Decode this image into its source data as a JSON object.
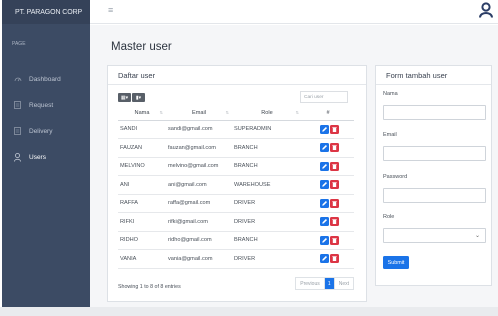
{
  "sidebar": {
    "brand": "PT. PARAGON CORP",
    "section_label": "PAGE",
    "items": [
      {
        "label": "Dashboard",
        "icon": "dashboard-icon"
      },
      {
        "label": "Request",
        "icon": "document-icon"
      },
      {
        "label": "Delivery",
        "icon": "document-icon"
      },
      {
        "label": "Users",
        "icon": "user-icon"
      }
    ],
    "active": "Users"
  },
  "topbar": {
    "menu_icon": "hamburger-icon",
    "user_icon": "user-circle-icon"
  },
  "page": {
    "title": "Master user"
  },
  "list": {
    "title": "Daftar user",
    "search_placeholder": "Cari user",
    "columns": [
      "Nama",
      "Email",
      "Role",
      "#"
    ],
    "rows": [
      {
        "nama": "SANDI",
        "email": "sandi@gmail.com",
        "role": "SUPERADMIN"
      },
      {
        "nama": "FAUZAN",
        "email": "fauzan@gmail.com",
        "role": "BRANCH"
      },
      {
        "nama": "MELVINO",
        "email": "melvino@gmail.com",
        "role": "BRANCH"
      },
      {
        "nama": "ANI",
        "email": "ani@gmail.com",
        "role": "WAREHOUSE"
      },
      {
        "nama": "RAFFA",
        "email": "raffa@gmail.com",
        "role": "DRIVER"
      },
      {
        "nama": "RIFKI",
        "email": "rifki@gmail.com",
        "role": "DRIVER"
      },
      {
        "nama": "RIDHO",
        "email": "ridho@gmail.com",
        "role": "BRANCH"
      },
      {
        "nama": "VANIA",
        "email": "vania@gmail.com",
        "role": "DRIVER"
      }
    ],
    "info": "Showing 1 to 8 of 8 entries",
    "pagination": {
      "prev": "Previous",
      "current": "1",
      "next": "Next"
    }
  },
  "form": {
    "title": "Form tambah user",
    "nama_label": "Nama",
    "email_label": "Email",
    "password_label": "Password",
    "role_label": "Role",
    "submit_label": "Submit"
  },
  "colors": {
    "sidebar": "#3c4b64",
    "primary": "#1a73e8",
    "danger": "#dc3545"
  }
}
